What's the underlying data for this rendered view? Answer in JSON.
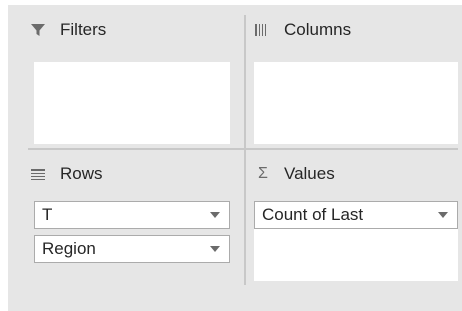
{
  "areas": {
    "filters": {
      "title": "Filters",
      "icon": "filter-funnel-icon"
    },
    "columns": {
      "title": "Columns",
      "icon": "columns-bars-icon"
    },
    "rows": {
      "title": "Rows",
      "icon": "rows-lines-icon",
      "fields": [
        "T",
        "Region"
      ]
    },
    "values": {
      "title": "Values",
      "icon": "sigma-icon",
      "icon_glyph": "Σ",
      "fields": [
        "Count of Last"
      ]
    }
  },
  "colors": {
    "panel_bg": "#e6e6e6",
    "box_bg": "#ffffff",
    "field_border": "#ababab",
    "icon_gray": "#6b6b6b"
  }
}
